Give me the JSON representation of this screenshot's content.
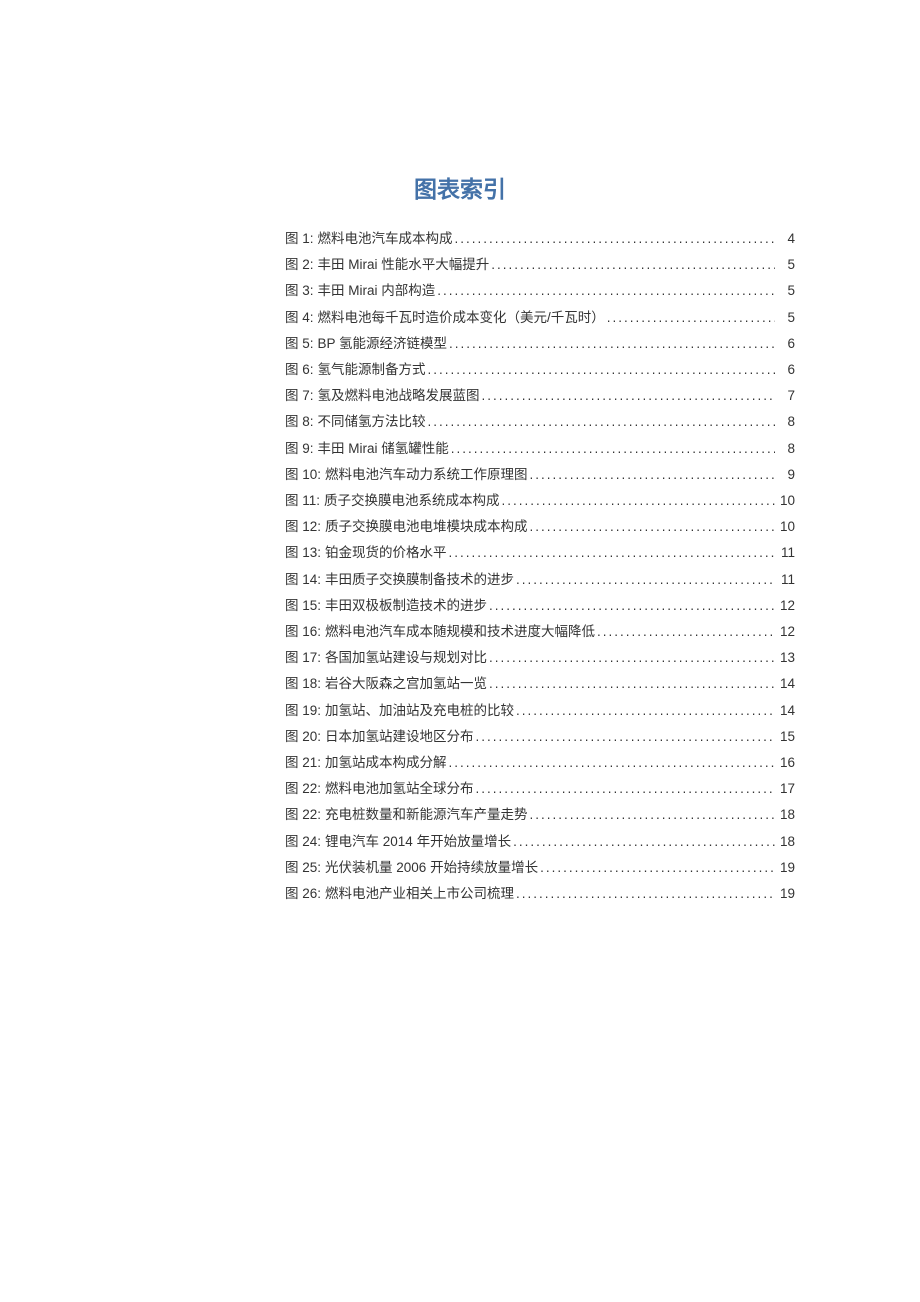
{
  "heading": "图表索引",
  "entries": [
    {
      "label": "图 1:",
      "title": "燃料电池汽车成本构成",
      "page": "4"
    },
    {
      "label": "图 2:",
      "title": "丰田 Mirai 性能水平大幅提升",
      "page": "5"
    },
    {
      "label": "图 3:",
      "title": "丰田 Mirai 内部构造",
      "page": "5"
    },
    {
      "label": "图 4:",
      "title": "燃料电池每千瓦时造价成本变化（美元/千瓦时）",
      "page": "5"
    },
    {
      "label": "图 5:",
      "title": "BP 氢能源经济链模型",
      "page": "6"
    },
    {
      "label": "图 6:",
      "title": "氢气能源制备方式",
      "page": "6"
    },
    {
      "label": "图 7:",
      "title": "氢及燃料电池战略发展蓝图",
      "page": "7"
    },
    {
      "label": "图 8:",
      "title": "不同储氢方法比较",
      "page": "8"
    },
    {
      "label": "图 9:",
      "title": "丰田 Mirai 储氢罐性能",
      "page": "8"
    },
    {
      "label": "图 10:",
      "title": "燃料电池汽车动力系统工作原理图",
      "page": "9"
    },
    {
      "label": "图 11:",
      "title": "质子交换膜电池系统成本构成",
      "page": "10"
    },
    {
      "label": "图 12:",
      "title": "质子交换膜电池电堆模块成本构成",
      "page": "10"
    },
    {
      "label": "图 13:",
      "title": "铂金现货的价格水平",
      "page": "11"
    },
    {
      "label": "图 14:",
      "title": "丰田质子交换膜制备技术的进步",
      "page": "11"
    },
    {
      "label": "图 15:",
      "title": "丰田双极板制造技术的进步",
      "page": "12"
    },
    {
      "label": "图 16:",
      "title": "燃料电池汽车成本随规模和技术进度大幅降低",
      "page": "12"
    },
    {
      "label": "图 17:",
      "title": "各国加氢站建设与规划对比",
      "page": "13"
    },
    {
      "label": "图 18:",
      "title": "岩谷大阪森之宫加氢站一览",
      "page": "14"
    },
    {
      "label": "图 19:",
      "title": "加氢站、加油站及充电桩的比较",
      "page": "14"
    },
    {
      "label": "图 20:",
      "title": "日本加氢站建设地区分布",
      "page": "15"
    },
    {
      "label": "图 21:",
      "title": "加氢站成本构成分解",
      "page": "16"
    },
    {
      "label": "图 22:",
      "title": "燃料电池加氢站全球分布",
      "page": "17"
    },
    {
      "label": "图 22:",
      "title": "充电桩数量和新能源汽车产量走势",
      "page": "18"
    },
    {
      "label": "图 24:",
      "title": "锂电汽车 2014 年开始放量增长",
      "page": "18"
    },
    {
      "label": "图 25:",
      "title": "光伏装机量 2006 开始持续放量增长",
      "page": "19"
    },
    {
      "label": "图 26:",
      "title": "燃料电池产业相关上市公司梳理",
      "page": "19"
    }
  ]
}
